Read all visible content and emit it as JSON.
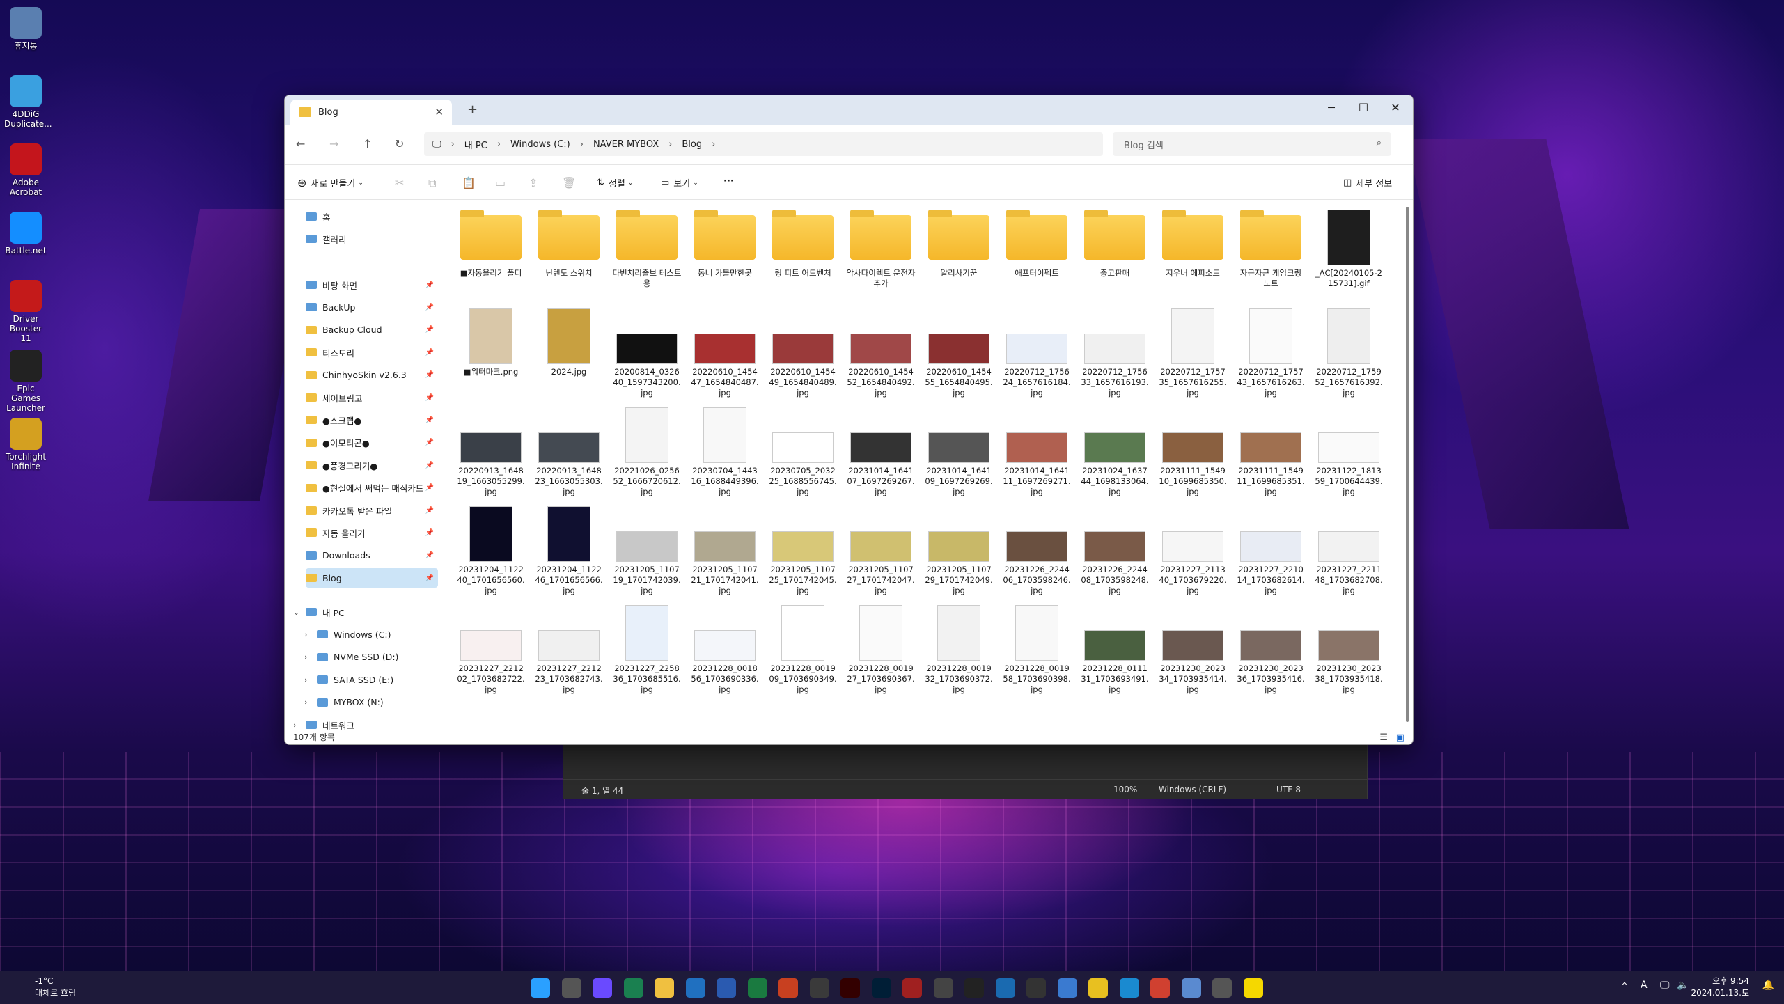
{
  "desktop_icons": [
    {
      "label": "휴지통",
      "icon": "recycle-bin-icon",
      "color": "#5a7fb0"
    },
    {
      "label": "4DDiG Duplicate...",
      "icon": "4ddig-icon",
      "color": "#3aa0e0"
    },
    {
      "label": "Adobe Acrobat",
      "icon": "acrobat-icon",
      "color": "#c4151c"
    },
    {
      "label": "Battle.net",
      "icon": "battlenet-icon",
      "color": "#148eff"
    },
    {
      "label": "Driver Booster 11",
      "icon": "driver-booster-icon",
      "color": "#c41a1a"
    },
    {
      "label": "Epic Games Launcher",
      "icon": "epic-games-icon",
      "color": "#222"
    },
    {
      "label": "Torchlight Infinite",
      "icon": "torchlight-icon",
      "color": "#d4a020"
    }
  ],
  "window": {
    "tab_title": "Blog",
    "new_tab": "+",
    "minimize": "─",
    "maximize": "☐",
    "close": "✕"
  },
  "address": {
    "crumbs": [
      "내 PC",
      "Windows (C:)",
      "NAVER MYBOX",
      "Blog"
    ],
    "search_placeholder": "Blog 검색"
  },
  "toolbar": {
    "new_label": "새로 만들기",
    "sort_label": "정렬",
    "view_label": "보기",
    "more_label": "···",
    "details_label": "세부 정보"
  },
  "sidebar": {
    "top": [
      {
        "label": "홈",
        "icon": "home-icon"
      },
      {
        "label": "갤러리",
        "icon": "gallery-icon"
      }
    ],
    "pinned": [
      {
        "label": "바탕 화면",
        "icon": "desktop-icon"
      },
      {
        "label": "BackUp",
        "icon": "drive-icon"
      },
      {
        "label": "Backup Cloud",
        "icon": "folder-icon"
      },
      {
        "label": "티스토리",
        "icon": "folder-icon"
      },
      {
        "label": "ChinhyoSkin v2.6.3",
        "icon": "folder-icon"
      },
      {
        "label": "세이브링고",
        "icon": "folder-icon"
      },
      {
        "label": "●스크랩●",
        "icon": "folder-icon"
      },
      {
        "label": "●이모티콘●",
        "icon": "folder-icon"
      },
      {
        "label": "●풍경그리기●",
        "icon": "folder-icon"
      },
      {
        "label": "●현실에서 써먹는 매직카드",
        "icon": "folder-icon"
      },
      {
        "label": "카카오톡 받은 파일",
        "icon": "folder-icon"
      },
      {
        "label": "자동 올리기",
        "icon": "folder-icon"
      },
      {
        "label": "Downloads",
        "icon": "download-icon"
      },
      {
        "label": "Blog",
        "icon": "folder-icon"
      }
    ],
    "tree": [
      {
        "label": "내 PC",
        "icon": "pc-icon",
        "expander": "⌄"
      },
      {
        "label": "Windows (C:)",
        "icon": "drive-icon",
        "expander": "›"
      },
      {
        "label": "NVMe SSD (D:)",
        "icon": "drive-icon",
        "expander": "›"
      },
      {
        "label": "SATA SSD (E:)",
        "icon": "drive-icon",
        "expander": "›"
      },
      {
        "label": "MYBOX (N:)",
        "icon": "mybox-icon",
        "expander": "›"
      },
      {
        "label": "네트워크",
        "icon": "network-icon",
        "expander": "›"
      }
    ]
  },
  "files": [
    {
      "name": "■자동올리기 폴더",
      "type": "folder",
      "color": "#f5b72a"
    },
    {
      "name": "닌텐도 스위치",
      "type": "folder",
      "color": "#f5b72a"
    },
    {
      "name": "다빈치리졸브 테스트용",
      "type": "folder",
      "color": "#f5b72a"
    },
    {
      "name": "동네 가볼만한곳",
      "type": "folder",
      "color": "#f5b72a"
    },
    {
      "name": "링 피트 어드벤처",
      "type": "folder",
      "color": "#f5b72a"
    },
    {
      "name": "악사다이렉트 운전자 추가",
      "type": "folder",
      "color": "#f5b72a"
    },
    {
      "name": "알리사기꾼",
      "type": "folder",
      "color": "#f5b72a"
    },
    {
      "name": "애프터이펙트",
      "type": "folder",
      "color": "#f5b72a"
    },
    {
      "name": "중고판매",
      "type": "folder",
      "color": "#f5b72a"
    },
    {
      "name": "지우버 에피소드",
      "type": "folder",
      "color": "#f5b72a"
    },
    {
      "name": "자근자근 게임크링 노트",
      "type": "folder",
      "color": "#f5b72a"
    },
    {
      "name": "_AC[20240105-215731].gif",
      "type": "image",
      "color": "#1e1e1e"
    },
    {
      "name": "■워터마크.png",
      "type": "image",
      "color": "#d9c7a8"
    },
    {
      "name": "2024.jpg",
      "type": "image",
      "color": "#c8a040"
    },
    {
      "name": "20200814_032640_1597343200.jpg",
      "type": "image",
      "color": "#111"
    },
    {
      "name": "20220610_145447_1654840487.jpg",
      "type": "image",
      "color": "#a83030"
    },
    {
      "name": "20220610_145449_1654840489.jpg",
      "type": "image",
      "color": "#9a3a3a"
    },
    {
      "name": "20220610_145452_1654840492.jpg",
      "type": "image",
      "color": "#a04848"
    },
    {
      "name": "20220610_145455_1654840495.jpg",
      "type": "image",
      "color": "#8a3030"
    },
    {
      "name": "20220712_175624_1657616184.jpg",
      "type": "image",
      "color": "#e8eef8"
    },
    {
      "name": "20220712_175633_1657616193.jpg",
      "type": "image",
      "color": "#f0f0f0"
    },
    {
      "name": "20220712_175735_1657616255.jpg",
      "type": "image",
      "color": "#f4f4f4"
    },
    {
      "name": "20220712_175743_1657616263.jpg",
      "type": "image",
      "color": "#fafafa"
    },
    {
      "name": "20220712_175952_1657616392.jpg",
      "type": "image",
      "color": "#eee"
    },
    {
      "name": "20220913_164819_1663055299.jpg",
      "type": "image",
      "color": "#3a4048"
    },
    {
      "name": "20220913_164823_1663055303.jpg",
      "type": "image",
      "color": "#444a52"
    },
    {
      "name": "20221026_025652_1666720612.jpg",
      "type": "image",
      "color": "#f4f4f4"
    },
    {
      "name": "20230704_144316_1688449396.jpg",
      "type": "image",
      "color": "#f8f8f8"
    },
    {
      "name": "20230705_203225_1688556745.jpg",
      "type": "image",
      "color": "#fff"
    },
    {
      "name": "20231014_164107_1697269267.jpg",
      "type": "image",
      "color": "#333"
    },
    {
      "name": "20231014_164109_1697269269.jpg",
      "type": "image",
      "color": "#555"
    },
    {
      "name": "20231014_164111_1697269271.jpg",
      "type": "image",
      "color": "#b06050"
    },
    {
      "name": "20231024_163744_1698133064.jpg",
      "type": "image",
      "color": "#5a7a50"
    },
    {
      "name": "20231111_154910_1699685350.jpg",
      "type": "image",
      "color": "#8a6040"
    },
    {
      "name": "20231111_154911_1699685351.jpg",
      "type": "image",
      "color": "#a07050"
    },
    {
      "name": "20231122_181359_1700644439.jpg",
      "type": "image",
      "color": "#fafafa"
    },
    {
      "name": "20231204_112240_1701656560.jpg",
      "type": "image",
      "color": "#0a0a20"
    },
    {
      "name": "20231204_112246_1701656566.jpg",
      "type": "image",
      "color": "#101030"
    },
    {
      "name": "20231205_110719_1701742039.jpg",
      "type": "image",
      "color": "#c8c8c8"
    },
    {
      "name": "20231205_110721_1701742041.jpg",
      "type": "image",
      "color": "#b0a890"
    },
    {
      "name": "20231205_110725_1701742045.jpg",
      "type": "image",
      "color": "#d8c878"
    },
    {
      "name": "20231205_110727_1701742047.jpg",
      "type": "image",
      "color": "#d0c070"
    },
    {
      "name": "20231205_110729_1701742049.jpg",
      "type": "image",
      "color": "#c8b868"
    },
    {
      "name": "20231226_224406_1703598246.jpg",
      "type": "image",
      "color": "#6a5040"
    },
    {
      "name": "20231226_224408_1703598248.jpg",
      "type": "image",
      "color": "#7a5a48"
    },
    {
      "name": "20231227_211340_1703679220.jpg",
      "type": "image",
      "color": "#f6f6f6"
    },
    {
      "name": "20231227_221014_1703682614.jpg",
      "type": "image",
      "color": "#e8ecf4"
    },
    {
      "name": "20231227_221148_1703682708.jpg",
      "type": "image",
      "color": "#f2f2f2"
    },
    {
      "name": "20231227_221202_1703682722.jpg",
      "type": "image",
      "color": "#f8f0f0"
    },
    {
      "name": "20231227_221223_1703682743.jpg",
      "type": "image",
      "color": "#f0f0f0"
    },
    {
      "name": "20231227_225836_1703685516.jpg",
      "type": "image",
      "color": "#e8f0fa"
    },
    {
      "name": "20231228_001856_1703690336.jpg",
      "type": "image",
      "color": "#f4f6fa"
    },
    {
      "name": "20231228_001909_1703690349.jpg",
      "type": "image",
      "color": "#fff"
    },
    {
      "name": "20231228_001927_1703690367.jpg",
      "type": "image",
      "color": "#fafafa"
    },
    {
      "name": "20231228_001932_1703690372.jpg",
      "type": "image",
      "color": "#f2f2f2"
    },
    {
      "name": "20231228_001958_1703690398.jpg",
      "type": "image",
      "color": "#f8f8f8"
    },
    {
      "name": "20231228_011131_1703693491.jpg",
      "type": "image",
      "color": "#4a6040"
    },
    {
      "name": "20231230_202334_1703935414.jpg",
      "type": "image",
      "color": "#6a5850"
    },
    {
      "name": "20231230_202336_1703935416.jpg",
      "type": "image",
      "color": "#7a6860"
    },
    {
      "name": "20231230_202338_1703935418.jpg",
      "type": "image",
      "color": "#8a7468"
    }
  ],
  "status": {
    "count": "107개 항목"
  },
  "notepad": {
    "position": "줄 1, 열 44",
    "zoom": "100%",
    "eol": "Windows (CRLF)",
    "encoding": "UTF-8"
  },
  "taskbar": {
    "weather_temp": "-1°C",
    "weather_desc": "대체로 흐림",
    "time": "오후 9:54",
    "date": "2024.01.13.토",
    "apps": [
      {
        "name": "start-button",
        "color": "#2aa0ff"
      },
      {
        "name": "search",
        "color": "#555"
      },
      {
        "name": "copilot",
        "color": "#6a4aff"
      },
      {
        "name": "upnote",
        "color": "#1a8050"
      },
      {
        "name": "file-explorer",
        "color": "#f0c040"
      },
      {
        "name": "outlook",
        "color": "#2070c0"
      },
      {
        "name": "word",
        "color": "#2a5ab0"
      },
      {
        "name": "excel",
        "color": "#1a7a40"
      },
      {
        "name": "powerpoint",
        "color": "#c84020"
      },
      {
        "name": "davinci",
        "color": "#3a3a3a"
      },
      {
        "name": "illustrator",
        "color": "#300"
      },
      {
        "name": "photoshop",
        "color": "#001e36"
      },
      {
        "name": "app-red",
        "color": "#a02020"
      },
      {
        "name": "app-cam",
        "color": "#444"
      },
      {
        "name": "capcut",
        "color": "#222"
      },
      {
        "name": "vscode",
        "color": "#1a6ab0"
      },
      {
        "name": "app-box",
        "color": "#333"
      },
      {
        "name": "notepad",
        "color": "#3a7ad0"
      },
      {
        "name": "sticky",
        "color": "#e8c020"
      },
      {
        "name": "edge",
        "color": "#1a8ad0"
      },
      {
        "name": "chrome",
        "color": "#d04030"
      },
      {
        "name": "app-globe",
        "color": "#5a8ad0"
      },
      {
        "name": "calculator",
        "color": "#555"
      },
      {
        "name": "kakaotalk",
        "color": "#f5d800"
      }
    ],
    "tray": [
      "^",
      "A"
    ]
  }
}
